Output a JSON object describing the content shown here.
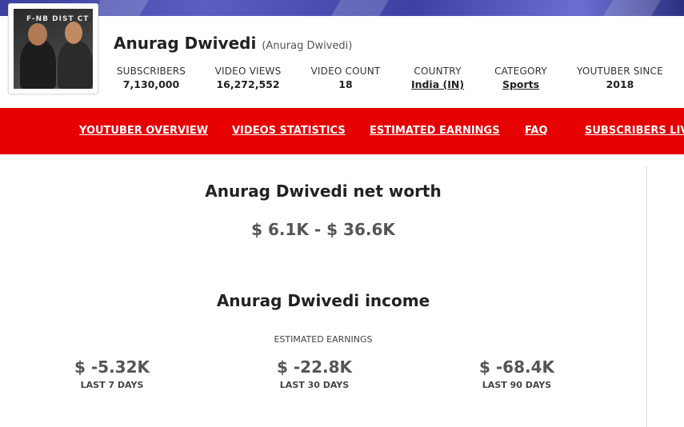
{
  "channel": {
    "name": "Anurag Dwivedi",
    "handle": "(Anurag Dwivedi)",
    "avatar_sign_text": "F-NB  DIST CT"
  },
  "stats": [
    {
      "label": "SUBSCRIBERS",
      "value": "7,130,000",
      "link": false
    },
    {
      "label": "VIDEO VIEWS",
      "value": "16,272,552",
      "link": false
    },
    {
      "label": "VIDEO COUNT",
      "value": "18",
      "link": false
    },
    {
      "label": "COUNTRY",
      "value": "India (IN)",
      "link": true
    },
    {
      "label": "CATEGORY",
      "value": "Sports",
      "link": true
    },
    {
      "label": "YOUTUBER SINCE",
      "value": "2018",
      "link": false
    }
  ],
  "nav": [
    {
      "label": "YOUTUBER OVERVIEW"
    },
    {
      "label": "VIDEOS STATISTICS"
    },
    {
      "label": "ESTIMATED EARNINGS"
    },
    {
      "label": "FAQ"
    },
    {
      "label": "SUBSCRIBERS LIVE C"
    }
  ],
  "networth": {
    "heading": "Anurag Dwivedi net worth",
    "range": "$ 6.1K - $ 36.6K"
  },
  "income": {
    "heading": "Anurag Dwivedi income",
    "label": "ESTIMATED EARNINGS",
    "periods": [
      {
        "value": "$ -5.32K",
        "label": "LAST 7 DAYS"
      },
      {
        "value": "$ -22.8K",
        "label": "LAST 30 DAYS"
      },
      {
        "value": "$ -68.4K",
        "label": "LAST 90 DAYS"
      }
    ]
  },
  "colors": {
    "nav_bg": "#e60000",
    "banner": "#4a4fb0"
  }
}
